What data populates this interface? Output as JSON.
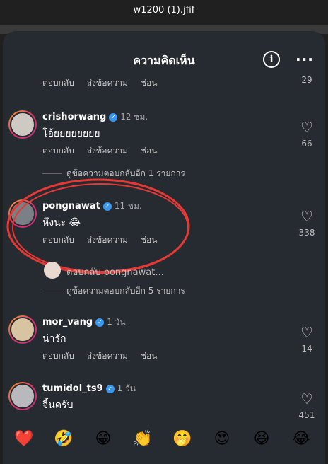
{
  "window": {
    "title": "w1200 (1).jfif"
  },
  "header": {
    "title": "ความคิดเห็น",
    "info_icon": "info-icon",
    "more_icon": "more-icon",
    "more_glyph": "···"
  },
  "top_partial": {
    "reply": "ตอบกลับ",
    "message": "ส่งข้อความ",
    "hide": "ซ่อน",
    "count": "29"
  },
  "comments": [
    {
      "user": "crishorwang",
      "time": "12 ชม.",
      "text": "โอ้ยยยยยยยย",
      "reply": "ตอบกลับ",
      "message": "ส่งข้อความ",
      "hide": "ซ่อน",
      "likes": "66"
    },
    {
      "user": "pongnawat",
      "time": "11 ชม.",
      "text": "หึงนะ 😂",
      "reply": "ตอบกลับ",
      "message": "ส่งข้อความ",
      "hide": "ซ่อน",
      "likes": "338"
    },
    {
      "user": "mor_vang",
      "time": "1 วัน",
      "text": "น่ารัก",
      "reply": "ตอบกลับ",
      "message": "ส่งข้อความ",
      "hide": "ซ่อน",
      "likes": "14"
    },
    {
      "user": "tumidol_ts9",
      "time": "1 วัน",
      "text": "จิ้นครับ",
      "likes": "451"
    }
  ],
  "view_replies_1": "ดูข้อความตอบกลับอีก 1 รายการ",
  "reply_preview": "ตอบกลับ pongnawat...",
  "view_replies_5": "ดูข้อความตอบกลับอีก 5 รายการ",
  "emojis": [
    "❤️",
    "🤣",
    "😁",
    "👏",
    "🤭",
    "😍",
    "😆",
    "😂"
  ],
  "annotation_color": "#e53935"
}
